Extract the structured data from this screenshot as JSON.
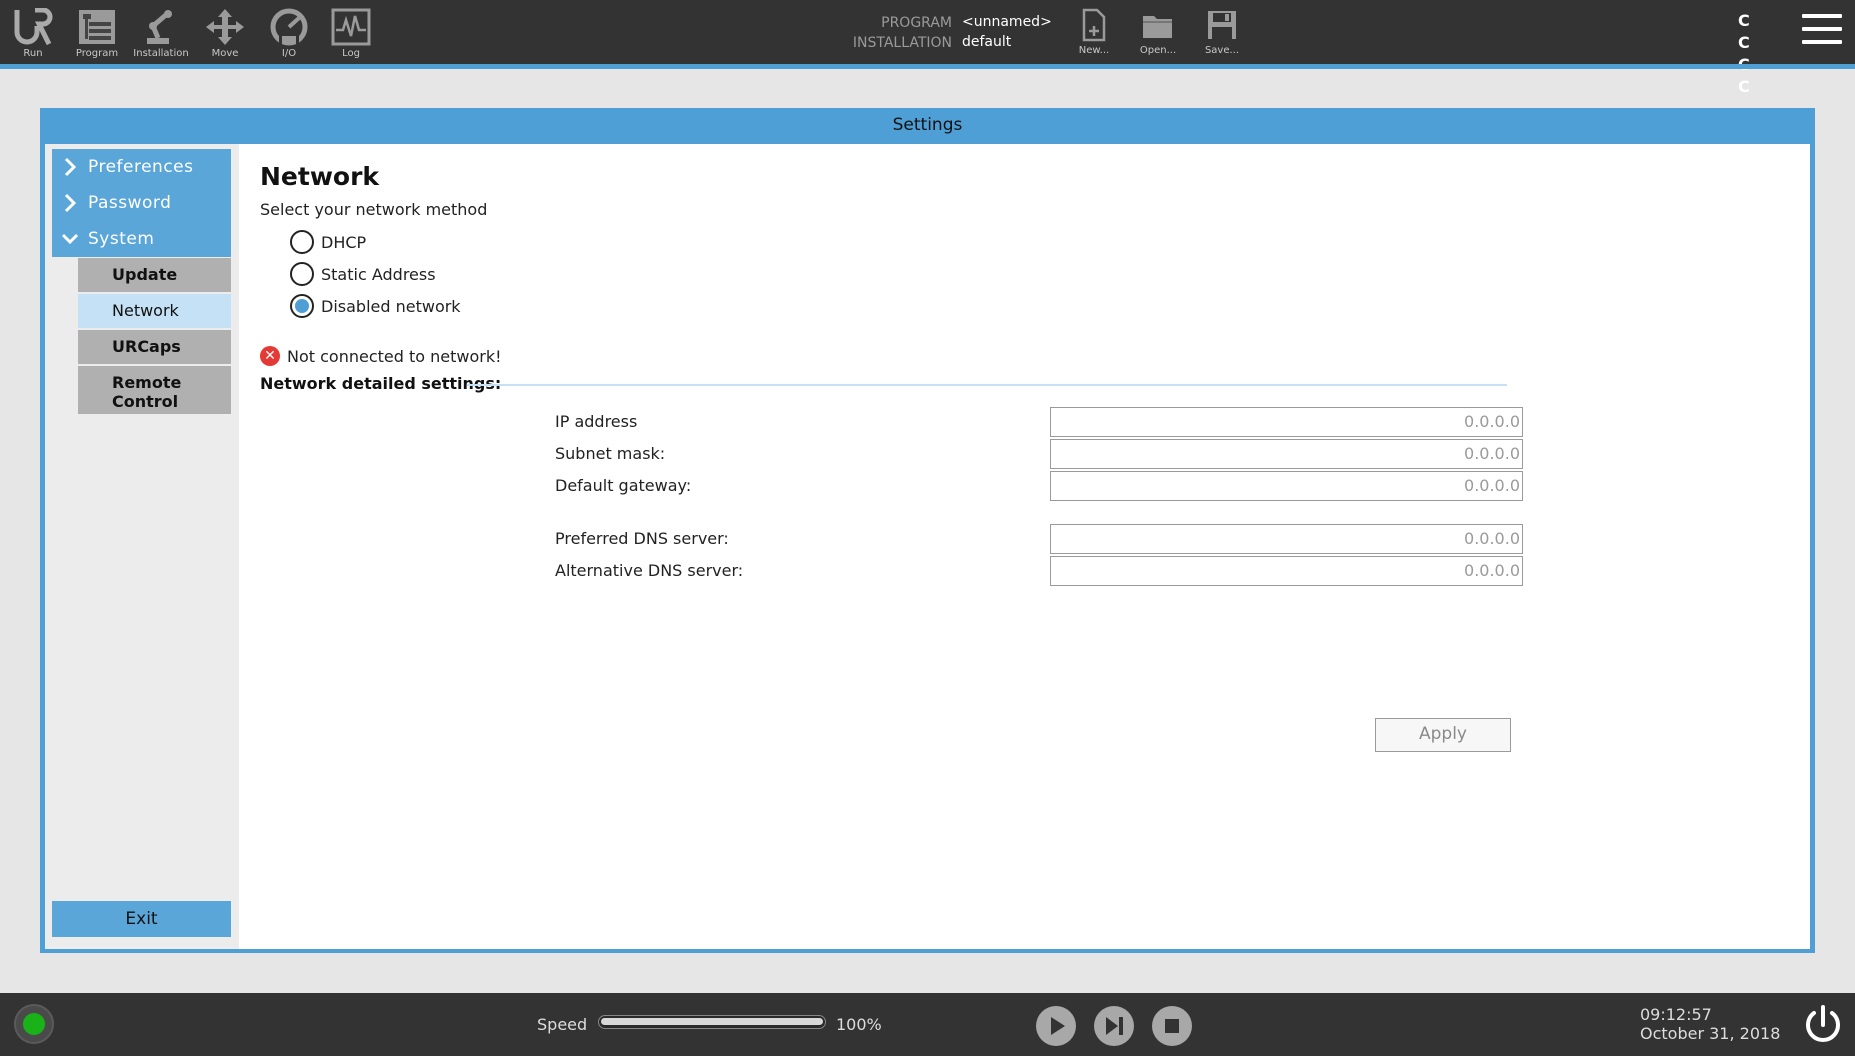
{
  "toolbar": {
    "nav": [
      {
        "label": "Run",
        "icon": "ur-logo-icon"
      },
      {
        "label": "Program",
        "icon": "program-tree-icon"
      },
      {
        "label": "Installation",
        "icon": "robot-arm-icon"
      },
      {
        "label": "Move",
        "icon": "move-arrows-icon"
      },
      {
        "label": "I/O",
        "icon": "io-gauge-icon"
      },
      {
        "label": "Log",
        "icon": "log-chart-icon"
      }
    ],
    "program_label": "PROGRAM",
    "program_value": "<unnamed>",
    "installation_label": "INSTALLATION",
    "installation_value": "default",
    "file": [
      {
        "label": "New...",
        "icon": "new-file-icon"
      },
      {
        "label": "Open...",
        "icon": "open-folder-icon"
      },
      {
        "label": "Save...",
        "icon": "save-disk-icon"
      }
    ],
    "cc_text": "C C C C"
  },
  "dialog": {
    "title": "Settings",
    "sidebar": {
      "preferences": "Preferences",
      "password": "Password",
      "system": "System",
      "update": "Update",
      "network": "Network",
      "urcaps": "URCaps",
      "remote_control": "Remote Control",
      "exit": "Exit"
    },
    "network": {
      "title": "Network",
      "subtitle": "Select your network method",
      "methods": [
        {
          "label": "DHCP",
          "checked": false
        },
        {
          "label": "Static Address",
          "checked": false
        },
        {
          "label": "Disabled network",
          "checked": true
        }
      ],
      "status": "Not connected to network!",
      "details_heading": "Network detailed settings:",
      "fields": {
        "ip_label": "IP address",
        "ip_value": "0.0.0.0",
        "subnet_label": "Subnet mask:",
        "subnet_value": "0.0.0.0",
        "gateway_label": "Default gateway:",
        "gateway_value": "0.0.0.0",
        "dns1_label": "Preferred DNS server:",
        "dns1_value": "0.0.0.0",
        "dns2_label": "Alternative DNS server:",
        "dns2_value": "0.0.0.0"
      },
      "apply": "Apply"
    }
  },
  "bottom": {
    "speed_label": "Speed",
    "speed_value": "100%",
    "speed_fraction": 1.0,
    "time": "09:12:57",
    "date": "October 31, 2018"
  },
  "colors": {
    "accent": "#4d9fd6",
    "topbar": "#333333",
    "status_ok": "#19b319",
    "error": "#e53935"
  }
}
